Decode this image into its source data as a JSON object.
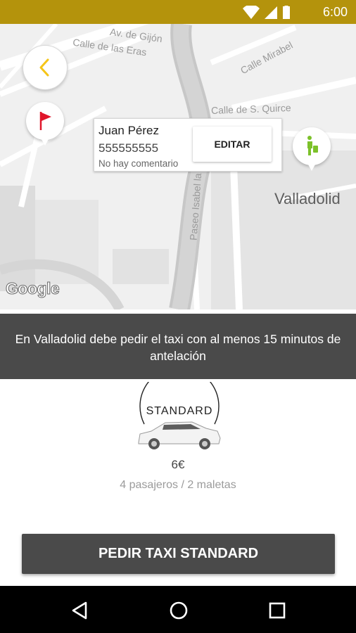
{
  "status_bar": {
    "time": "6:00"
  },
  "map": {
    "streets": [
      "Av. de Gijón",
      "Calle de las Eras",
      "Calle Mirabel",
      "Calle de S. Quirce",
      "Paseo Isabel la"
    ],
    "city": "Valladolid",
    "attribution": "Google"
  },
  "contact_card": {
    "name": "Juan Pérez",
    "phone": "555555555",
    "comment": "No hay comentario",
    "edit_label": "EDITAR"
  },
  "notice": "En Valladolid debe pedir el taxi con al menos 15 minutos de antelación",
  "taxi": {
    "type_label": "STANDARD",
    "price": "6€",
    "capacity": "4 pasajeros / 2 maletas"
  },
  "order_button": "PEDIR TAXI STANDARD",
  "colors": {
    "accent": "#b4930c",
    "dark": "#4a4a4a",
    "flag": "#e0162b",
    "passenger": "#7cc12a",
    "back_chevron": "#f5c518"
  },
  "icons": [
    "back-chevron-icon",
    "flag-icon",
    "passenger-icon",
    "wifi-icon",
    "signal-icon",
    "battery-icon",
    "nav-back-icon",
    "nav-home-icon",
    "nav-recents-icon"
  ]
}
